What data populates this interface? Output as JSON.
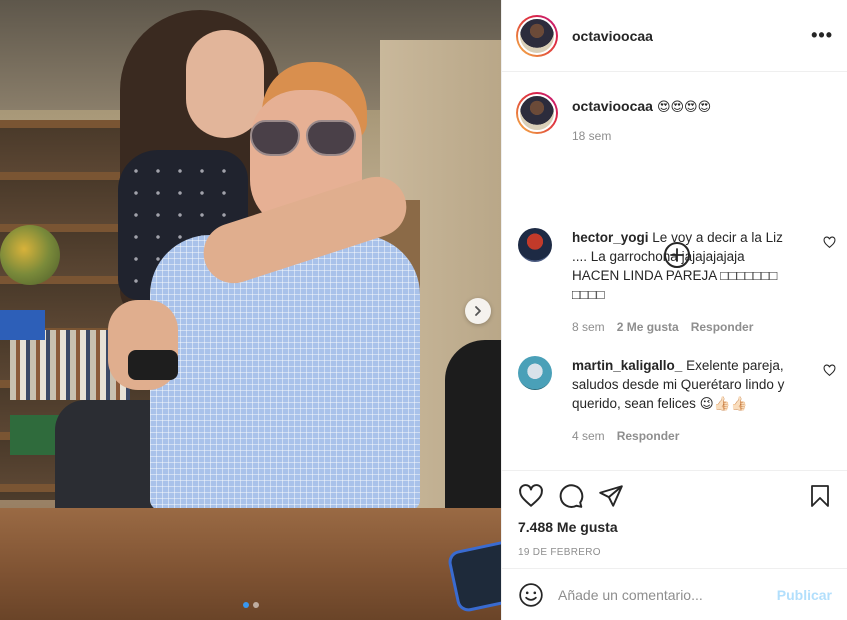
{
  "post": {
    "username": "octavioocaa",
    "carousel": {
      "slide_count": 2,
      "active_index": 0
    }
  },
  "caption": {
    "username": "octavioocaa",
    "text": "😍😍😍😍",
    "time": "18 sem"
  },
  "comments": [
    {
      "username": "hector_yogi",
      "text": "Le voy a decir a la Liz .... La garrochona jajajajajaja HACEN LINDA PAREJA □□□□□□□ □□□□",
      "time": "8 sem",
      "likes": "2 Me gusta",
      "reply_label": "Responder"
    },
    {
      "username": "martin_kaligallo_",
      "text": "Exelente pareja, saludos desde mi Querétaro lindo y querido, sean felices 😉👍🏻👍🏻",
      "time": "4 sem",
      "reply_label": "Responder"
    }
  ],
  "stats": {
    "likes": "7.488 Me gusta",
    "date": "19 DE FEBRERO"
  },
  "add_comment": {
    "placeholder": "Añade un comentario...",
    "publish_label": "Publicar"
  },
  "icons": {
    "more": "more-options-icon",
    "add": "plus-circle-icon",
    "like": "heart-icon",
    "comment": "comment-icon",
    "share": "share-icon",
    "save": "bookmark-icon",
    "emoji": "emoji-icon",
    "next": "chevron-right-icon"
  },
  "colors": {
    "accent": "#3897f0",
    "publish_disabled": "#b2dffc",
    "muted": "#8e8e8e",
    "text": "#262626"
  }
}
